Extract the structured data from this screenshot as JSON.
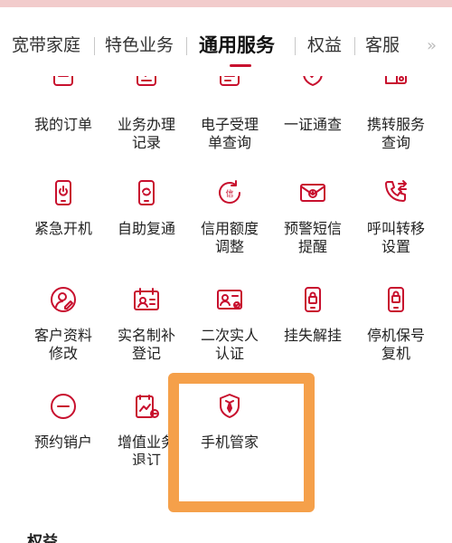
{
  "tabs": [
    {
      "label": "宽带家庭",
      "active": false
    },
    {
      "label": "特色业务",
      "active": false
    },
    {
      "label": "通用服务",
      "active": true
    },
    {
      "label": "权益",
      "active": false
    },
    {
      "label": "客服",
      "active": false
    }
  ],
  "services": [
    {
      "label": "我的订单",
      "icon": "order-icon"
    },
    {
      "label": "业务办理\n记录",
      "icon": "record-icon"
    },
    {
      "label": "电子受理\n单查询",
      "icon": "receipt-icon"
    },
    {
      "label": "一证通查",
      "icon": "shield-check-icon"
    },
    {
      "label": "携转服务\n查询",
      "icon": "transfer-icon"
    },
    {
      "label": "紧急开机",
      "icon": "phone-power-icon"
    },
    {
      "label": "自助复通",
      "icon": "phone-refresh-icon"
    },
    {
      "label": "信用额度\n调整",
      "icon": "credit-icon"
    },
    {
      "label": "预警短信\n提醒",
      "icon": "alert-sms-icon"
    },
    {
      "label": "呼叫转移\n设置",
      "icon": "call-forward-icon"
    },
    {
      "label": "客户资料\n修改",
      "icon": "profile-edit-icon"
    },
    {
      "label": "实名制补\n登记",
      "icon": "realname-icon"
    },
    {
      "label": "二次实人\n认证",
      "icon": "id-card-icon"
    },
    {
      "label": "挂失解挂",
      "icon": "lock-phone-icon"
    },
    {
      "label": "停机保号\n复机",
      "icon": "phone-lock-icon"
    },
    {
      "label": "预约销户",
      "icon": "cancel-icon"
    },
    {
      "label": "增值业务\n退订",
      "icon": "doc-chart-icon"
    },
    {
      "label": "手机管家",
      "icon": "guard-icon"
    }
  ],
  "section_title": "权益",
  "colors": {
    "accent": "#c8102e",
    "highlight": "#f5a04a",
    "top_strip": "#f2cccc"
  }
}
